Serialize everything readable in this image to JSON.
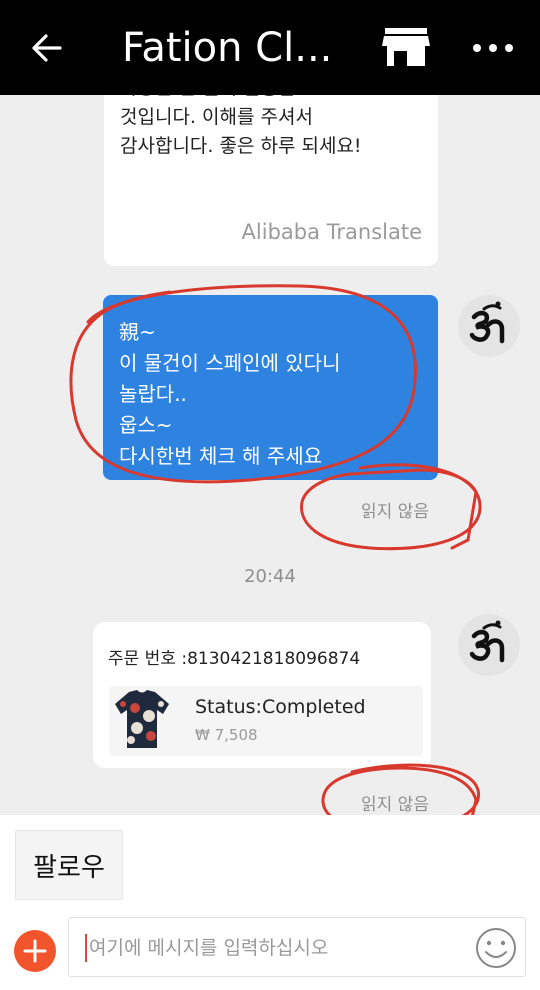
{
  "header": {
    "title": "Fation Cl...",
    "back_icon": "arrow-left-icon",
    "store_icon": "store-icon",
    "more_icon": "more-horizontal-icon"
  },
  "messages": {
    "incoming_translated": {
      "text": "가능한 한 빨리 발송할\n것입니다. 이해를 주셔서\n감사합니다. 좋은 하루 되세요!",
      "credit": "Alibaba Translate"
    },
    "outgoing": {
      "text": "親~\n이 물건이 스페인에  있다니\n놀랍다..\n웁스~\n다시한번 체크 해 주세요",
      "read_status": "읽지 않음"
    },
    "time_divider": "20:44",
    "order_card": {
      "order_number": "주문 번호 :8130421818096874",
      "status": "Status:Completed",
      "price": "₩ 7,508",
      "read_status": "읽지 않음"
    }
  },
  "footer": {
    "follow_label": "팔로우",
    "input_placeholder": "여기에 메시지를 입력하십시오",
    "add_icon": "plus-icon",
    "emoji_icon": "smiley-icon"
  },
  "colors": {
    "header_bg": "#000000",
    "outgoing_bubble": "#2f83e0",
    "add_button": "#f2552c",
    "annotation_red": "#d8392e"
  }
}
